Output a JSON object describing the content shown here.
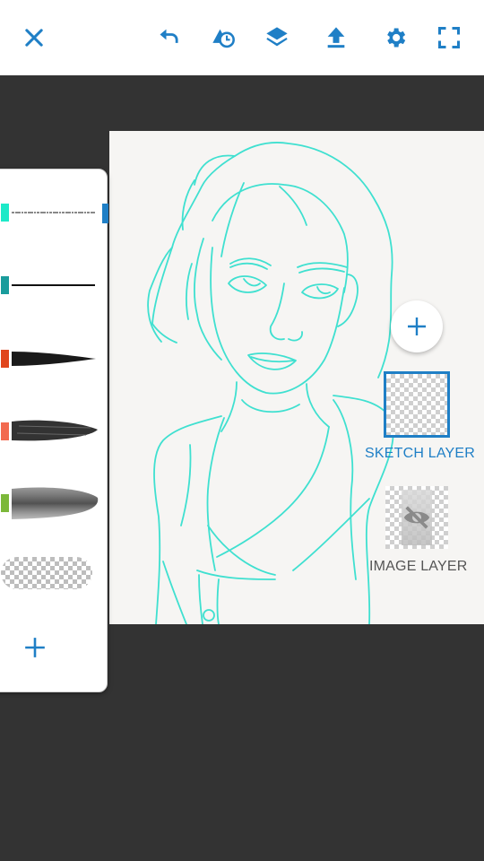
{
  "toolbar": {
    "icons": [
      "close-icon",
      "undo-icon",
      "shape-icon",
      "layers-icon",
      "upload-icon",
      "gear-icon",
      "fullscreen-icon"
    ]
  },
  "brushes": [
    {
      "name": "pencil",
      "swatch_color": "#1de9c8"
    },
    {
      "name": "ink-pen",
      "swatch_color": "#1a9c9c"
    },
    {
      "name": "tapered-brush",
      "swatch_color": "#e0451c"
    },
    {
      "name": "dry-brush",
      "swatch_color": "#f26a50"
    },
    {
      "name": "watercolor",
      "swatch_color": "#7cb83a"
    },
    {
      "name": "eraser",
      "swatch_color": "#ffffff"
    }
  ],
  "layers": {
    "sketch_label": "SKETCH LAYER",
    "image_label": "IMAGE LAYER"
  },
  "colors": {
    "accent": "#1f7fc6",
    "sketch_stroke": "#3fe0d0",
    "background": "#333333",
    "canvas": "#f6f5f3"
  }
}
